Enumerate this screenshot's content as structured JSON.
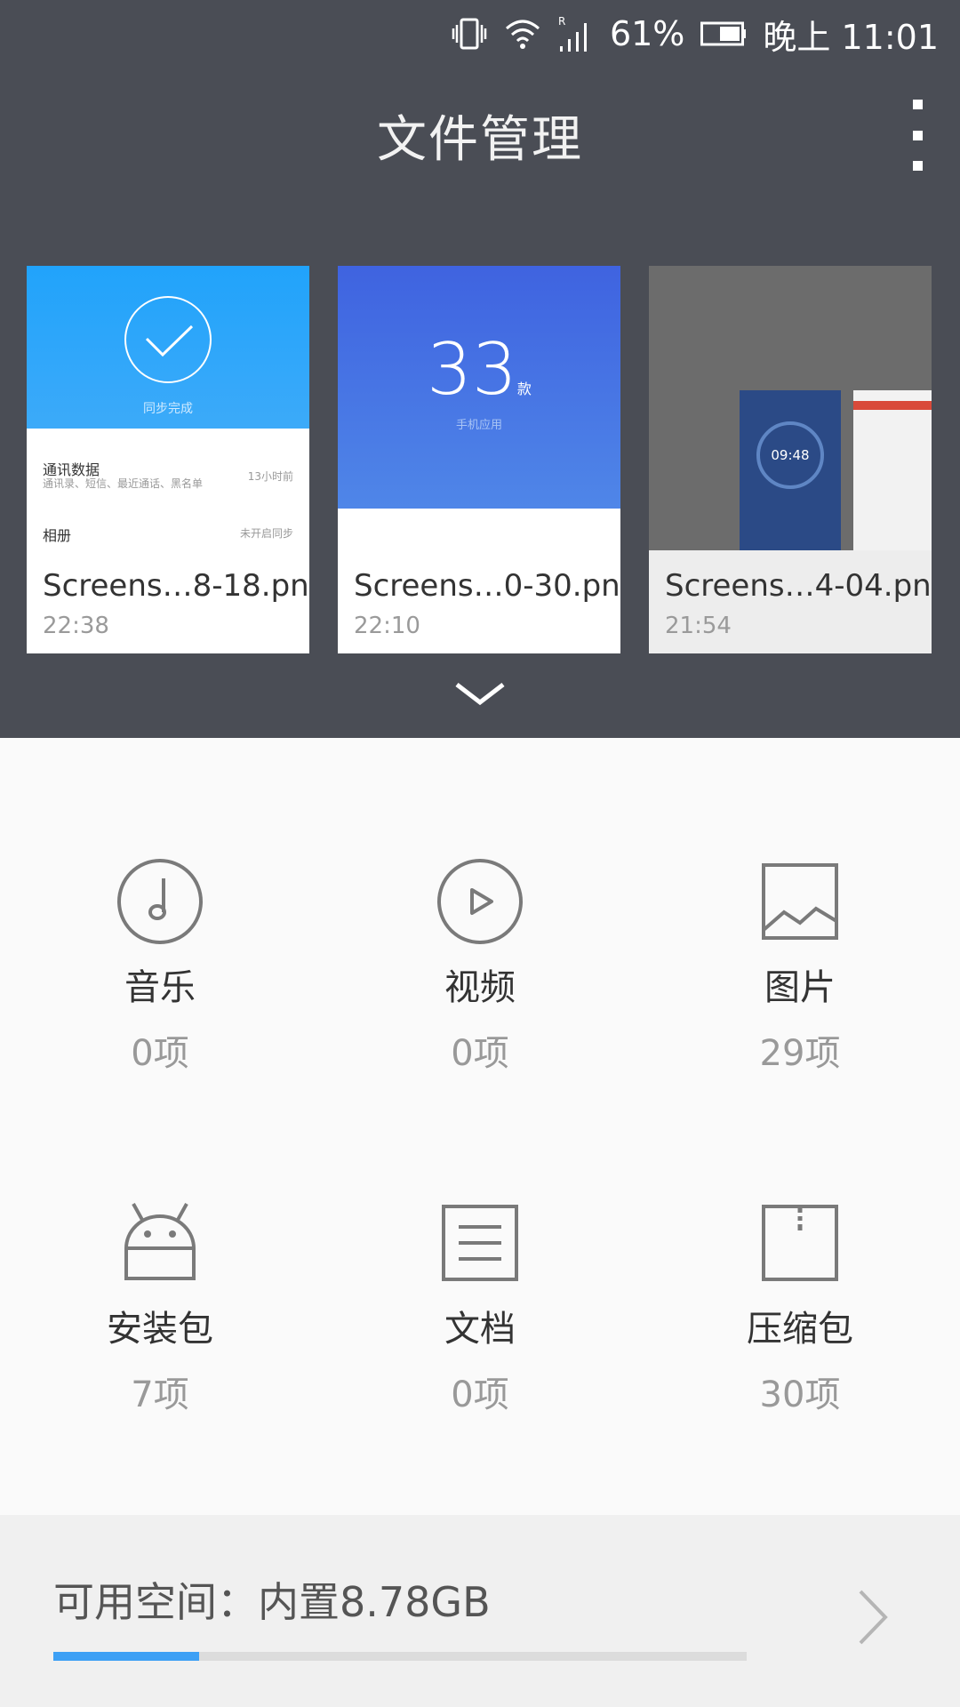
{
  "status_bar": {
    "battery_percent": "61%",
    "time": "晚上 11:01",
    "icons": [
      "vibrate-icon",
      "wifi-icon",
      "signal-icon",
      "battery-icon"
    ]
  },
  "header": {
    "title": "文件管理"
  },
  "recent_files": [
    {
      "file_name": "Screens…8-18.png",
      "time": "22:38",
      "preview": {
        "banner_text": "同步完成",
        "row1_title": "通讯数据",
        "row1_subtitle": "通讯录、短信、最近通话、黑名单",
        "row1_right": "13小时前",
        "row2_title": "相册",
        "row2_right": "未开启同步"
      }
    },
    {
      "file_name": "Screens…0-30.png",
      "time": "22:10",
      "preview": {
        "big_number": "33",
        "unit": "款",
        "subtitle": "手机应用"
      }
    },
    {
      "file_name": "Screens…4-04.png",
      "time": "21:54",
      "preview": {
        "clock_text": "09:48"
      }
    }
  ],
  "categories": [
    {
      "name": "音乐",
      "count": "0项",
      "icon": "music-icon"
    },
    {
      "name": "视频",
      "count": "0项",
      "icon": "video-icon"
    },
    {
      "name": "图片",
      "count": "29项",
      "icon": "image-icon"
    },
    {
      "name": "安装包",
      "count": "7项",
      "icon": "android-icon"
    },
    {
      "name": "文档",
      "count": "0项",
      "icon": "document-icon"
    },
    {
      "name": "压缩包",
      "count": "30项",
      "icon": "archive-icon"
    }
  ],
  "storage": {
    "label": "可用空间：内置8.78GB",
    "used_fraction": 0.21
  },
  "colors": {
    "header_bg": "#4a4d55",
    "accent": "#3da0f5",
    "icon_gray": "#7a7a7a"
  }
}
